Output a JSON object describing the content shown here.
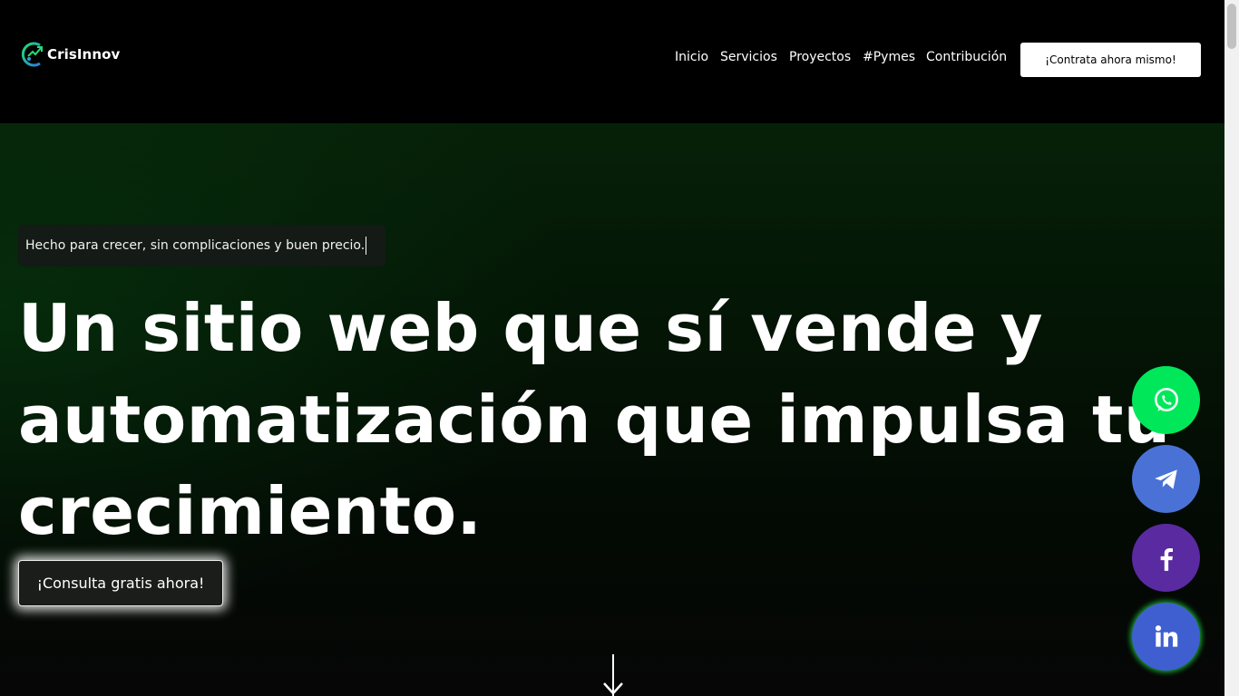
{
  "brand": {
    "name": "CrisInnov"
  },
  "nav": {
    "items": [
      {
        "label": "Inicio"
      },
      {
        "label": "Servicios"
      },
      {
        "label": "Proyectos"
      },
      {
        "label": "#Pymes"
      },
      {
        "label": "Contribución"
      }
    ],
    "cta_label": "¡Contrata ahora mismo!"
  },
  "hero": {
    "tagline": "Hecho para crecer, sin complicaciones y buen precio.",
    "headline": "Un sitio web que sí vende y automatización que impulsa tu crecimiento.",
    "consult_label": "¡Consulta gratis ahora!"
  },
  "social": [
    {
      "icon": "whatsapp-icon",
      "color": "#00e85a"
    },
    {
      "icon": "telegram-icon",
      "color": "#4a72d6"
    },
    {
      "icon": "facebook-icon",
      "color": "#5a2aa0"
    },
    {
      "icon": "linkedin-icon",
      "color": "#3f5fd0"
    }
  ],
  "colors": {
    "background": "#000000",
    "accent_green": "#1bd05a",
    "cta_background": "#ffffff"
  }
}
